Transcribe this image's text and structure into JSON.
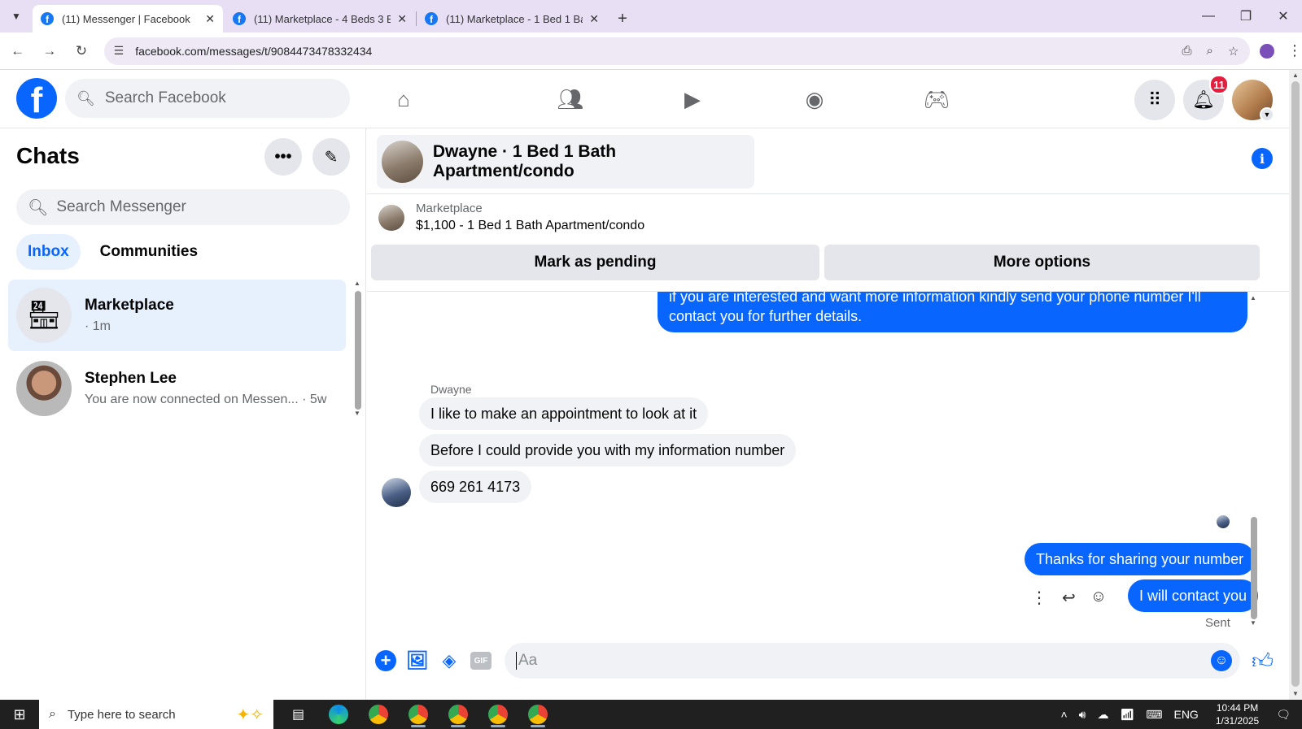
{
  "browser": {
    "tabs": [
      {
        "label": "(11) Messenger | Facebook",
        "active": true
      },
      {
        "label": "(11) Marketplace - 4 Beds 3 Bat",
        "active": false
      },
      {
        "label": "(11) Marketplace - 1 Bed 1 Bath",
        "active": false
      }
    ],
    "url": "facebook.com/messages/t/9084473478332434"
  },
  "fb_header": {
    "logo": "f",
    "search_placeholder": "Search Facebook",
    "notification_count": "11"
  },
  "chats_panel": {
    "title": "Chats",
    "search_placeholder": "Search Messenger",
    "filters": [
      "Inbox",
      "Communities"
    ],
    "items": [
      {
        "name": "Marketplace",
        "sub": "· 1m",
        "selected": true
      },
      {
        "name": "Stephen Lee",
        "sub": "You are now connected on Messen... · 5w",
        "selected": false
      }
    ]
  },
  "conversation": {
    "header_name": "Dwayne · 1 Bed 1 Bath Apartment/condo",
    "marketplace_label": "Marketplace",
    "listing": "$1,100 - 1 Bed 1 Bath Apartment/condo",
    "mark_pending": "Mark as pending",
    "more_options": "More options",
    "sender_name": "Dwayne",
    "messages": [
      {
        "dir": "out",
        "text": "if you are interested and want more information kindly send your phone number I'll contact you for further details."
      },
      {
        "dir": "in",
        "text": "I like to make an appointment to look at it"
      },
      {
        "dir": "in",
        "text": "Before I could provide you with my information number"
      },
      {
        "dir": "in",
        "text": "669 261 4173"
      },
      {
        "dir": "out",
        "text": "Thanks for sharing your number"
      },
      {
        "dir": "out",
        "text": "I will contact you"
      }
    ],
    "sent_status": "Sent",
    "composer_placeholder": "Aa",
    "gif_label": "GIF"
  },
  "taskbar": {
    "search_placeholder": "Type here to search",
    "language": "ENG",
    "time": "10:44 PM",
    "date": "1/31/2025"
  },
  "colors": {
    "facebook_blue": "#0866ff",
    "bubble_in": "#f0f2f5",
    "badge_red": "#e41e3f"
  }
}
